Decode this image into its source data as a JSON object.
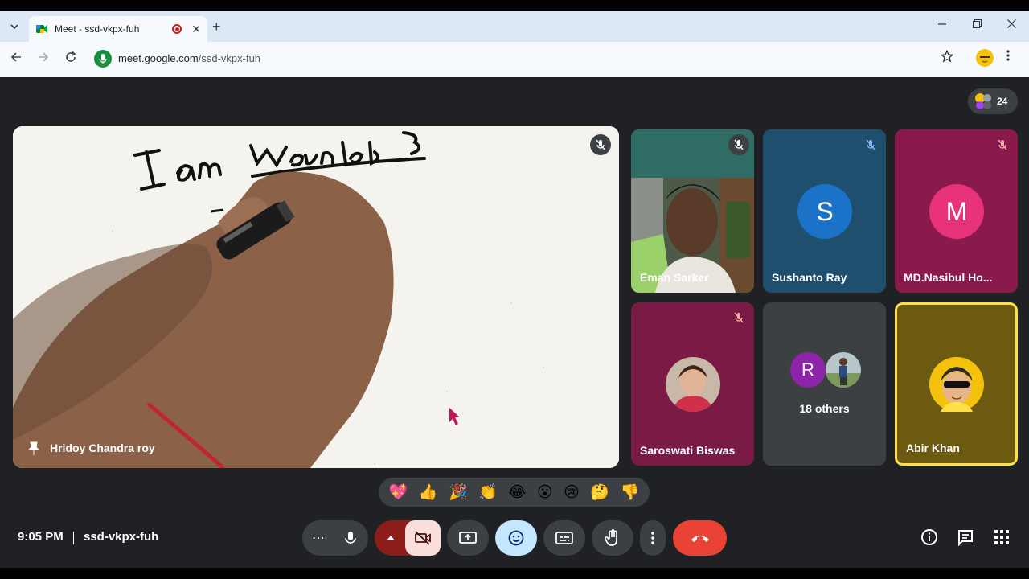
{
  "browser": {
    "tab_title": "Meet - ssd-vkpx-fuh",
    "url_host": "meet.google.com",
    "url_path": "/ssd-vkpx-fuh",
    "menu_icon": "chevron-down-icon",
    "new_tab_label": "+",
    "close_glyph": "✕"
  },
  "meet": {
    "participant_count": "24",
    "main_speaker": "Hridoy Chandra roy",
    "whiteboard_text": "I am Nounlab",
    "tiles": [
      {
        "name": "Eman Sarker",
        "type": "video",
        "muted": true
      },
      {
        "name": "Sushanto Ray",
        "type": "letter",
        "letter": "S",
        "color": "#1a73c8",
        "bg": "#1f4f6e",
        "muted": true
      },
      {
        "name": "MD.Nasibul Ho...",
        "type": "letter",
        "letter": "M",
        "color": "#e8337a",
        "bg": "#8b1a4c",
        "muted": true
      },
      {
        "name": "Saroswati Biswas",
        "type": "photo",
        "bg": "#7a1b45",
        "muted": true
      },
      {
        "name": "18 others",
        "type": "others",
        "letter": "R",
        "bg": "#3c4043"
      },
      {
        "name": "Abir Khan",
        "type": "photo",
        "bg": "#6b5a10",
        "highlight": "#fde047"
      }
    ]
  },
  "reactions": [
    "💖",
    "👍",
    "🎉",
    "👏",
    "😂",
    "😮",
    "😢",
    "🤔",
    "👎"
  ],
  "footer": {
    "time": "9:05 PM",
    "meeting_code": "ssd-vkpx-fuh",
    "more_label": "⋯"
  },
  "colors": {
    "bg": "#202124",
    "control": "#3c4043",
    "end_call": "#ea4335",
    "camera_off": "#f9dedc",
    "emoji_active": "#c2e7ff"
  }
}
